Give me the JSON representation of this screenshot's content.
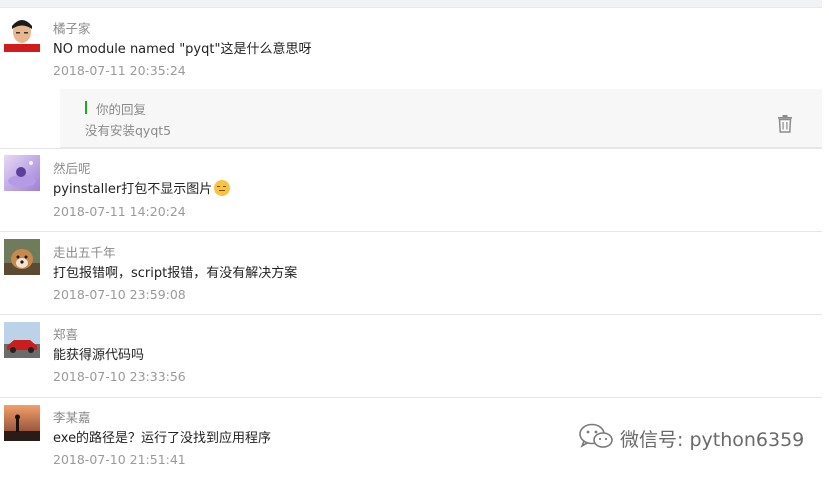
{
  "comments": [
    {
      "nickname": "橘子家",
      "text": "NO module named \"pyqt\"这是什么意思呀",
      "date": "2018-07-11 20:35:24",
      "reply": {
        "label": "你的回复",
        "text": "没有安装qyqt5"
      }
    },
    {
      "nickname": "然后呢",
      "text": "pyinstaller打包不显示图片",
      "date": "2018-07-11 14:20:24"
    },
    {
      "nickname": "走出五千年",
      "text": "打包报错啊，script报错，有没有解决方案",
      "date": "2018-07-10 23:59:08"
    },
    {
      "nickname": "郑喜",
      "text": "能获得源代码吗",
      "date": "2018-07-10 23:33:56"
    },
    {
      "nickname": "李某嘉",
      "text": "exe的路径是？运行了没找到应用程序",
      "date": "2018-07-10 21:51:41"
    }
  ],
  "watermark": {
    "text": "微信号: python6359"
  },
  "icons": {
    "delete": "trash-icon",
    "emoji": "pensive-face-emoji",
    "wechat": "wechat-logo-icon"
  },
  "colors": {
    "accent": "#1aad19",
    "nickname": "#8a8a8a",
    "date": "#9a9a9a"
  }
}
